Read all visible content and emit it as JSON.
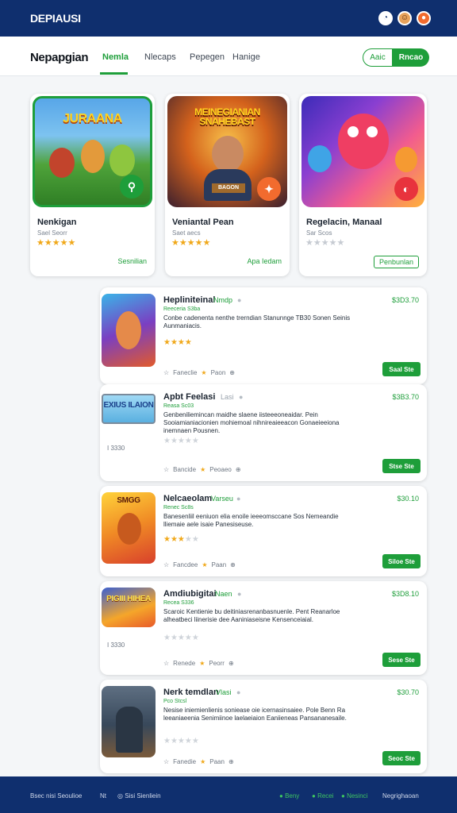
{
  "app": {
    "brand": "DEPIAUSI"
  },
  "topbar": {
    "icons": [
      "user-icon",
      "avatar-icon",
      "notification-icon"
    ],
    "icon_glyphs": [
      "◔",
      "☺",
      "●"
    ]
  },
  "nav": {
    "title": "Nepapgian",
    "tabs": [
      {
        "label": "Nemla"
      },
      {
        "label": "Nlecaps"
      },
      {
        "label": "Pepegen"
      },
      {
        "label": "Hanige"
      }
    ],
    "action_left": "Aaic",
    "action_right": "Rncao"
  },
  "featured": [
    {
      "art_title": "JURAANA",
      "title": "Nenkigan",
      "sub": "Sael Seorr",
      "stars": "★★★★★",
      "action": "Sesnilian",
      "badge": "⚲"
    },
    {
      "art_title": "MEINEGIANIAN SNAHEBAST",
      "art_label": "BAGON",
      "title": "Veniantal Pean",
      "sub": "Saet aecs",
      "stars": "★★★★★",
      "action": "Apa Iedam",
      "badge": "✦"
    },
    {
      "art_title": "",
      "title": "Regelacin, Manaal",
      "sub": "Sar Scos",
      "stars": "★★★★★",
      "action": "Penbunlan",
      "badge": "◐"
    }
  ],
  "list": [
    {
      "title": "Hepliniteinal",
      "tag": "Nmdp",
      "price": "$3D3.70",
      "sub": "Reeceria S3ba",
      "desc": "Conbe cadenenta nenthe trerndian Stanunnge TB30 Sonen Seinis Aunmaniacis.",
      "rating_on": "★★★★",
      "rating_off": "",
      "meta": [
        "Faneclie",
        "Paon"
      ],
      "button": "Saal Ste",
      "art": "",
      "side": ""
    },
    {
      "title": "Apbt Feelasi",
      "tag": "Lasi",
      "price": "$3B3.70",
      "sub": "Reasa Sc03",
      "desc": "Genbeniliemincan maidhe slaene iisteeeoneaidar. Pein Sooiamianiacionien mohiemoal nihnireaieeacon Gonaeieeiona inemnaen Pousnen.",
      "rating_on": "",
      "rating_off": "★★★★★",
      "meta": [
        "Bancide",
        "Peoaeo"
      ],
      "button": "Stse Ste",
      "art": "EXIUS ILAION",
      "side": "I 3330"
    },
    {
      "title": "Nelcaeolam",
      "tag": "Varseu",
      "price": "$30.10",
      "sub": "Renec Sc8s",
      "desc": "Banesenliil eeniuon elia enoile ieeeomsccane Sos Nemeandie lliemaie aele isaie Panesiseuse.",
      "rating_on": "★★★",
      "rating_off": "★★",
      "meta": [
        "Fancdee",
        "Paan"
      ],
      "button": "Siloe Ste",
      "art": "SMGG",
      "side": ""
    },
    {
      "title": "Amdiubigitai",
      "tag": "Naen",
      "price": "$3D8.10",
      "sub": "Recea S336",
      "desc": "Scaroic Kentienie bu deitiniasrenanbasnuenle. Pent Reanarloe alheatbeci liinerisie dee Aaniniaseisne Kensenceiaial.",
      "rating_on": "",
      "rating_off": "★★★★★",
      "meta": [
        "Renede",
        "Peorr"
      ],
      "button": "Sese Ste",
      "art": "PIGIII HIHEA",
      "side": "I 3330"
    },
    {
      "title": "Nerk temdlan",
      "tag": "Vlasi",
      "price": "$30.70",
      "sub": "Pco Stcsl",
      "desc": "Nesise iniemienlienis soniease oie icernasinsaiee. Pole Benn Ra leeaniaeenia Senimiinoe laelaeiaion Eaniieneas Pansananesaile.",
      "rating_on": "",
      "rating_off": "★★★★★",
      "meta": [
        "Fanedie",
        "Paan"
      ],
      "button": "Seoc Ste",
      "art": "",
      "side": ""
    }
  ],
  "footer": {
    "left": [
      "Bsec nisi Seoulioe",
      "Nt",
      "Sisi Sienliein"
    ],
    "right": [
      "Beny",
      "Recei",
      "Nesinci",
      "Negrighaoan"
    ]
  },
  "colors": {
    "accent": "#1e9e3a",
    "header": "#0f2f6e",
    "star": "#f0a81a"
  }
}
